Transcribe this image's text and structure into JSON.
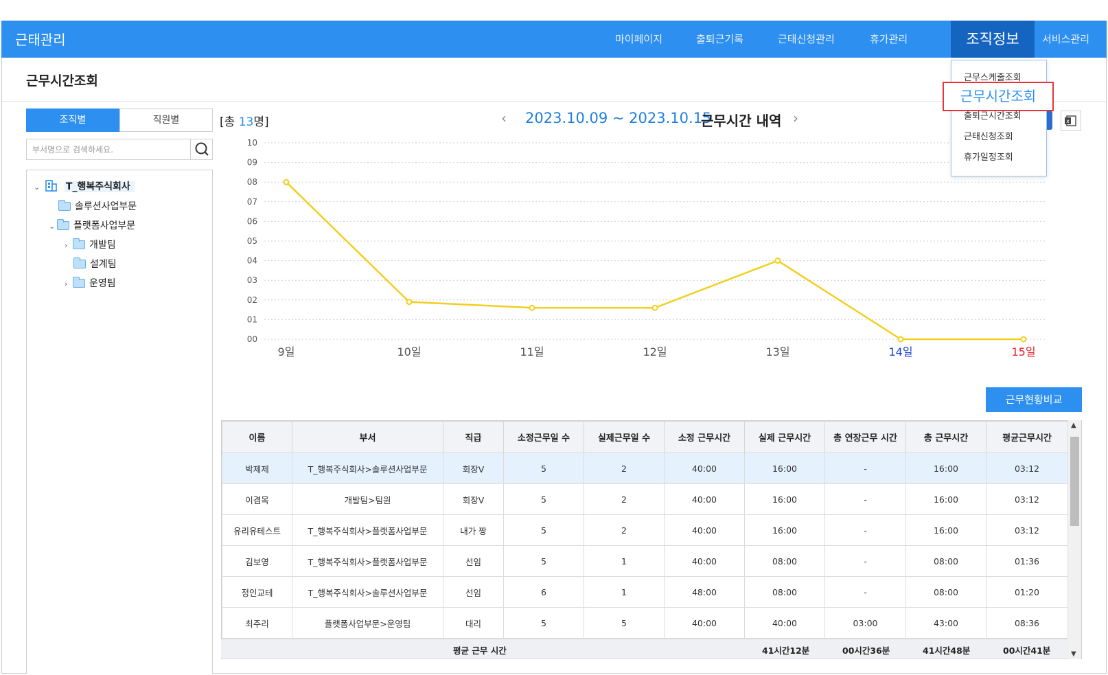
{
  "app_title": "근태관리",
  "nav": [
    {
      "label": "마이페이지"
    },
    {
      "label": "출퇴근기록"
    },
    {
      "label": "근태신청관리"
    },
    {
      "label": "휴가관리"
    },
    {
      "label": "조직정보"
    },
    {
      "label": "서비스관리"
    }
  ],
  "page_title": "근무시간조회",
  "tabs": {
    "by_org": "조직별",
    "by_employee": "직원별"
  },
  "search": {
    "placeholder": "부서명으로 검색하세요."
  },
  "tree": {
    "root": "T_행복주식회사",
    "items": [
      "솔루션사업부문",
      "플랫폼사업부문",
      "개발팀",
      "설계팀",
      "운영팀"
    ]
  },
  "summary": {
    "prefix": "[총 ",
    "count": "13",
    "suffix": "명]"
  },
  "period": {
    "range": "2023.10.09 ~ 2023.10.15",
    "label": "근무시간 내역",
    "prev": "‹",
    "next": "›"
  },
  "dropdown": {
    "items": [
      "근무스케줄조회",
      "근무시간조회",
      "출퇴근시간조회",
      "근태신청조회",
      "휴가일정조회"
    ],
    "selected": "근무시간조회"
  },
  "chart_data": {
    "type": "line",
    "categories": [
      "9일",
      "10일",
      "11일",
      "12일",
      "13일",
      "14일",
      "15일"
    ],
    "values": [
      8,
      1.9,
      1.6,
      1.6,
      4,
      0,
      0
    ],
    "yticks": [
      "00",
      "01",
      "02",
      "03",
      "04",
      "05",
      "06",
      "07",
      "08",
      "09",
      "10"
    ],
    "ylim": [
      0,
      10
    ],
    "grid": true,
    "line_color": "#f2cf1d",
    "category_colors": [
      "#555555",
      "#555555",
      "#555555",
      "#555555",
      "#555555",
      "#1a3fd6",
      "#e8202a"
    ]
  },
  "compare_button": "근무현황비교",
  "table": {
    "headers": [
      "이름",
      "부서",
      "직급",
      "소정근무일 수",
      "실제근무일 수",
      "소정 근무시간",
      "실제 근무시간",
      "총 연장근무 시간",
      "총 근무시간",
      "평균근무시간"
    ],
    "rows": [
      [
        "박제제",
        "T_행복주식회사>솔루션사업부문",
        "회장V",
        "5",
        "2",
        "40:00",
        "16:00",
        "-",
        "16:00",
        "03:12"
      ],
      [
        "이겸목",
        "개발팀>팀원",
        "회장V",
        "5",
        "2",
        "40:00",
        "16:00",
        "-",
        "16:00",
        "03:12"
      ],
      [
        "유리유테스트",
        "T_행복주식회사>플랫폼사업부문",
        "내가 짱",
        "5",
        "2",
        "40:00",
        "16:00",
        "-",
        "16:00",
        "03:12"
      ],
      [
        "김보영",
        "T_행복주식회사>플랫폼사업부문",
        "선임",
        "5",
        "1",
        "40:00",
        "08:00",
        "-",
        "08:00",
        "01:36"
      ],
      [
        "정인교테",
        "T_행복주식회사>솔루션사업부문",
        "선임",
        "6",
        "1",
        "48:00",
        "08:00",
        "-",
        "08:00",
        "01:20"
      ],
      [
        "최주리",
        "플랫폼사업부문>운영팀",
        "대리",
        "5",
        "5",
        "40:00",
        "40:00",
        "03:00",
        "43:00",
        "08:36"
      ]
    ],
    "footer": {
      "label": "평균 근무 시간",
      "actual": "41시간12분",
      "overtime": "00시간36분",
      "total": "41시간48분",
      "average": "00시간41분"
    }
  }
}
